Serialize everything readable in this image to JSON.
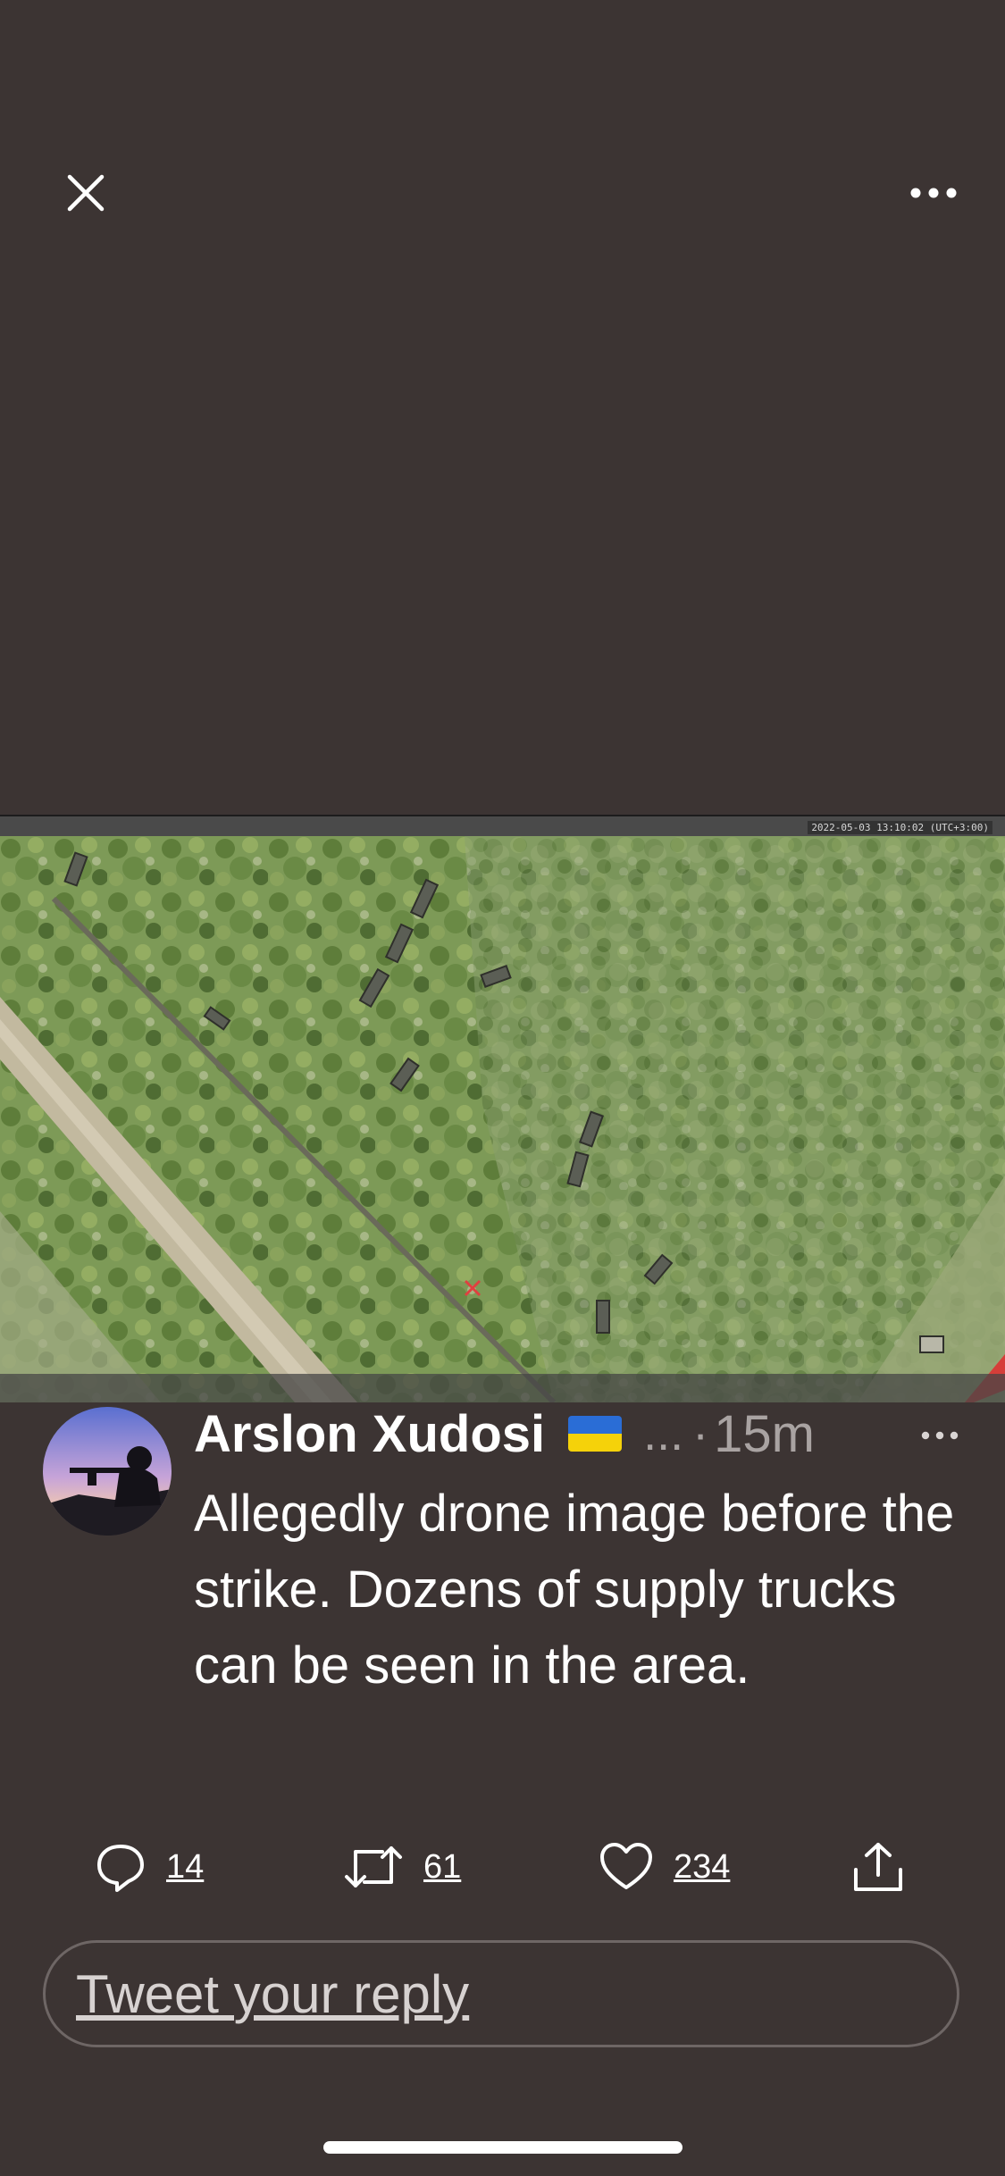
{
  "viewer": {
    "close_icon": "close-icon",
    "more_icon": "more-horizontal-icon"
  },
  "media": {
    "timestamp": "2022-05-03 13:10:02 (UTC+3:00)"
  },
  "tweet": {
    "author_name": "Arslon Xudosi",
    "flag_icon": "ukraine-flag-icon",
    "truncation": "...",
    "separator": "·",
    "time": "15m",
    "text": "Allegedly drone image before the strike. Dozens of supply trucks can be seen in the area."
  },
  "actions": {
    "reply_count": "14",
    "retweet_count": "61",
    "like_count": "234"
  },
  "reply_box": {
    "placeholder": "Tweet your reply"
  },
  "colors": {
    "background": "#3c3433",
    "secondary_text": "#a9a3a2",
    "text": "#ffffff"
  }
}
